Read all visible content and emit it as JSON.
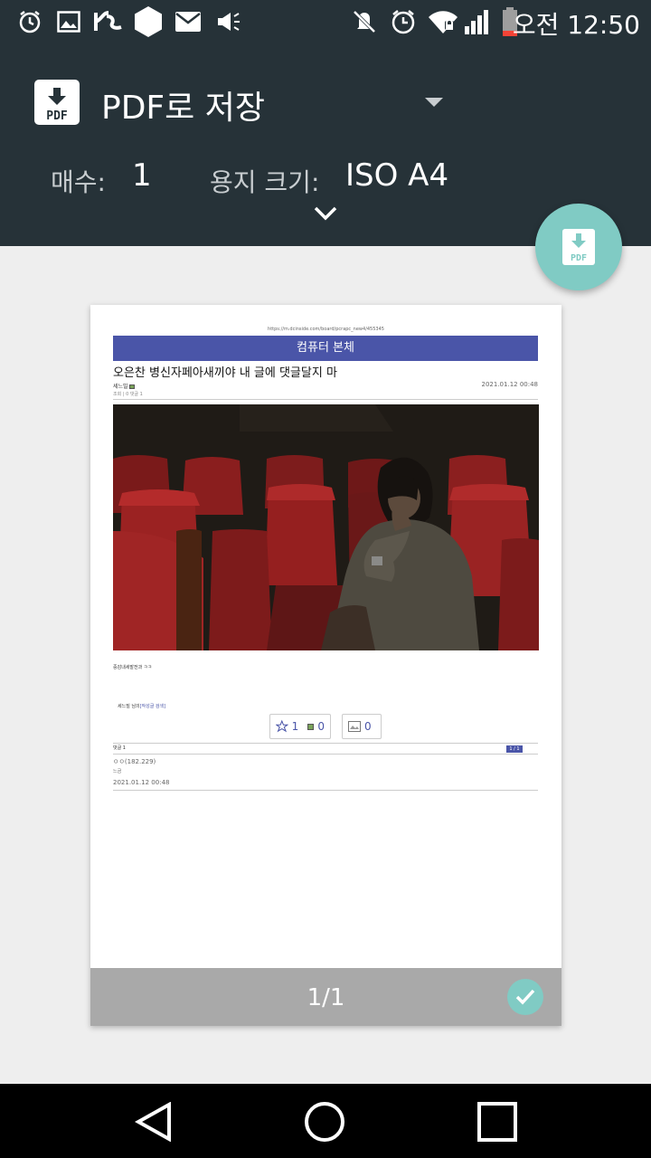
{
  "status_bar": {
    "icons": [
      "alarm-icon",
      "image-icon",
      "carrier-icon",
      "hexagon-icon",
      "mail-icon",
      "megaphone-icon",
      "mute-icon",
      "alarm-clock-icon",
      "wifi-icon",
      "signal-icon",
      "battery-icon"
    ],
    "time": "오전 12:50"
  },
  "header": {
    "title": "PDF로 저장",
    "pdf_logo_text": "PDF",
    "copies_label": "매수:",
    "copies_value": "1",
    "paper_label": "용지 크기:",
    "paper_value": "ISO A4"
  },
  "fab": {
    "icon": "pdf-download-icon",
    "text": "PDF",
    "color": "#80cbc4"
  },
  "preview": {
    "page_number": "1/1",
    "url": "https://m.dcinside.com/board/pcrapc_new4/455345",
    "board_name": "컴퓨터 본체",
    "post_title": "오은찬 병신자페아새끼야 내 글에 댓글달지 마",
    "author": "세느빌",
    "date": "2021.01.12 00:48",
    "views": "조회 | 0 댓글 1",
    "body_text": "중감내세발전과 ㅋㅋ",
    "signature_prefix": "세느빌 님의",
    "signature_link": "[작성글 검색]",
    "vote_up": "1",
    "vote_fixed": "0",
    "vote_image": "0",
    "comments_label": "댓글 1",
    "pager": "1 / 1",
    "comment_author": "ㅇㅇ(182.229)",
    "comment_text": "느금",
    "comment_date": "2021.01.12 00:48"
  },
  "nav": {
    "icons": [
      "back-icon",
      "home-icon",
      "recents-icon"
    ]
  },
  "colors": {
    "header_bg": "#263238",
    "accent": "#80cbc4",
    "board_bar": "#4a55a8"
  }
}
